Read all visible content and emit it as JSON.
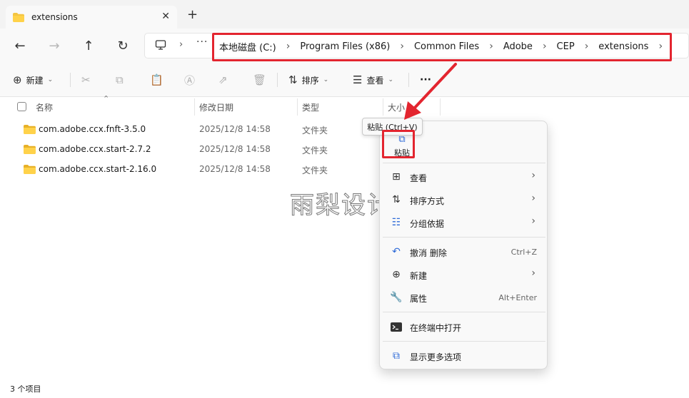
{
  "window": {
    "tab_title": "extensions",
    "tab_close": "✕",
    "new_tab": "+"
  },
  "nav": {
    "back": "←",
    "forward": "→",
    "up": "↑",
    "refresh": "↻",
    "more": "···",
    "sep": "›"
  },
  "breadcrumb": [
    "本地磁盘 (C:)",
    "Program Files (x86)",
    "Common Files",
    "Adobe",
    "CEP",
    "extensions"
  ],
  "toolbar": {
    "new_label": "新建",
    "sort_label": "排序",
    "view_label": "查看",
    "more": "···"
  },
  "columns": {
    "name": "名称",
    "date": "修改日期",
    "type": "类型",
    "size": "大小"
  },
  "files": [
    {
      "name": "com.adobe.ccx.fnft-3.5.0",
      "date": "2025/12/8 14:58",
      "type": "文件夹"
    },
    {
      "name": "com.adobe.ccx.start-2.7.2",
      "date": "2025/12/8 14:58",
      "type": "文件夹"
    },
    {
      "name": "com.adobe.ccx.start-2.16.0",
      "date": "2025/12/8 14:58",
      "type": "文件夹"
    }
  ],
  "status": "3 个项目",
  "watermark": "雨梨设计",
  "context_menu": {
    "paste_label": "粘贴",
    "tooltip": "粘贴 (Ctrl+V)",
    "items": [
      {
        "label": "查看",
        "icon": "grid-icon",
        "submenu": true
      },
      {
        "label": "排序方式",
        "icon": "sort-icon",
        "submenu": true
      },
      {
        "label": "分组依据",
        "icon": "group-icon",
        "submenu": true
      },
      {
        "label": "撤消 删除",
        "icon": "undo-icon",
        "shortcut": "Ctrl+Z"
      },
      {
        "label": "新建",
        "icon": "new-icon",
        "submenu": true
      },
      {
        "label": "属性",
        "icon": "properties-icon",
        "shortcut": "Alt+Enter"
      },
      {
        "label": "在终端中打开",
        "icon": "terminal-icon"
      },
      {
        "label": "显示更多选项",
        "icon": "more-options-icon"
      }
    ],
    "arrow": "›"
  },
  "colors": {
    "accent": "#2f6bd8",
    "annotation_red": "#e3252f",
    "folder_yellow": "#f4c542"
  }
}
